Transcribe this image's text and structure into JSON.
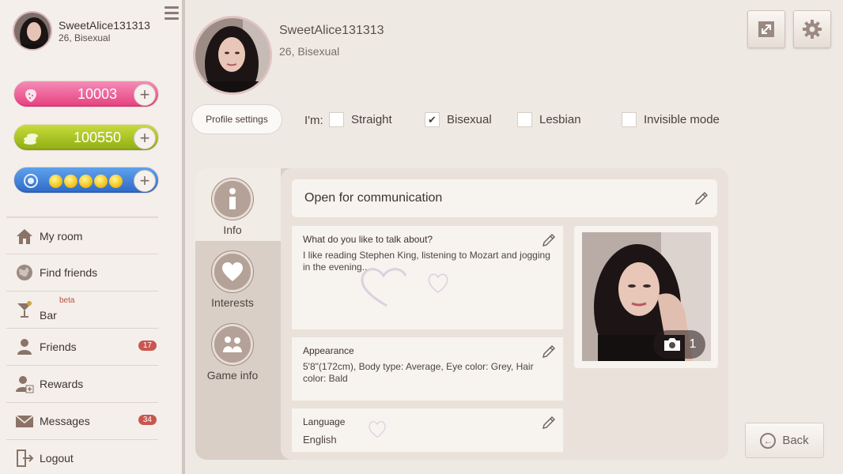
{
  "sidebar": {
    "user": {
      "name": "SweetAlice131313",
      "sub": "26, Bisexual"
    },
    "currencies": {
      "hearts": "10003",
      "coins": "100550"
    },
    "nav": [
      {
        "label": "My room",
        "icon": "house-icon"
      },
      {
        "label": "Find friends",
        "icon": "globe-icon"
      },
      {
        "label": "Bar",
        "icon": "cocktail-icon",
        "tag": "beta"
      },
      {
        "label": "Friends",
        "icon": "person-icon",
        "badge": "17"
      },
      {
        "label": "Rewards",
        "icon": "reward-person-icon"
      },
      {
        "label": "Messages",
        "icon": "envelope-icon",
        "badge": "34"
      },
      {
        "label": "Logout",
        "icon": "logout-icon"
      }
    ]
  },
  "profile": {
    "name": "SweetAlice131313",
    "sub": "26, Bisexual",
    "settings_button": "Profile settings",
    "im_label": "I'm:",
    "orientations": [
      {
        "label": "Straight",
        "checked": false
      },
      {
        "label": "Bisexual",
        "checked": true
      },
      {
        "label": "Lesbian",
        "checked": false
      }
    ],
    "invisible": {
      "label": "Invisible mode",
      "checked": false
    }
  },
  "tabs": [
    {
      "label": "Info"
    },
    {
      "label": "Interests"
    },
    {
      "label": "Game info"
    }
  ],
  "info": {
    "status": "Open for communication",
    "talk": {
      "title": "What do you like to talk about?",
      "text": "I like reading Stephen King, listening to Mozart and jogging in the evening..."
    },
    "appearance": {
      "title": "Appearance",
      "text": "5'8\"(172cm), Body type: Average, Eye color: Grey, Hair color: Bald"
    },
    "language": {
      "title": "Language",
      "text": "English"
    },
    "photo_count": "1"
  },
  "back_button": "Back",
  "colors": {
    "accent": "#b4a197",
    "badge": "#c9574f"
  }
}
